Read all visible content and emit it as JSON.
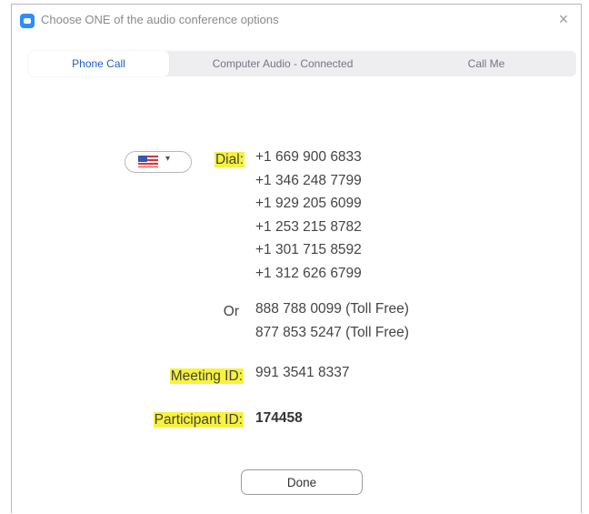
{
  "window": {
    "title": "Choose ONE of the audio conference options",
    "close_glyph": "×",
    "icon": "zoom-app-icon"
  },
  "tabs": [
    {
      "label": "Phone Call",
      "active": true
    },
    {
      "label": "Computer Audio - Connected",
      "active": false
    },
    {
      "label": "Call Me",
      "active": false
    }
  ],
  "dial": {
    "country": "United States",
    "country_flag_icon": "us-flag-icon",
    "label": "Dial:",
    "numbers": [
      "+1 669 900 6833",
      "+1 346 248 7799",
      "+1 929 205 6099",
      "+1 253 215 8782",
      "+1 301 715 8592",
      "+1 312 626 6799"
    ]
  },
  "or": {
    "label": "Or",
    "numbers": [
      "888 788 0099 (Toll Free)",
      "877 853 5247 (Toll Free)"
    ]
  },
  "meeting_id": {
    "label": "Meeting ID:",
    "value": "991 3541 8337"
  },
  "participant_id": {
    "label": "Participant ID:",
    "value": "174458"
  },
  "done_label": "Done",
  "colors": {
    "highlight": "#f7f23c",
    "active_tab_text": "#1f5fc8",
    "zoom_blue": "#2d8cff"
  }
}
